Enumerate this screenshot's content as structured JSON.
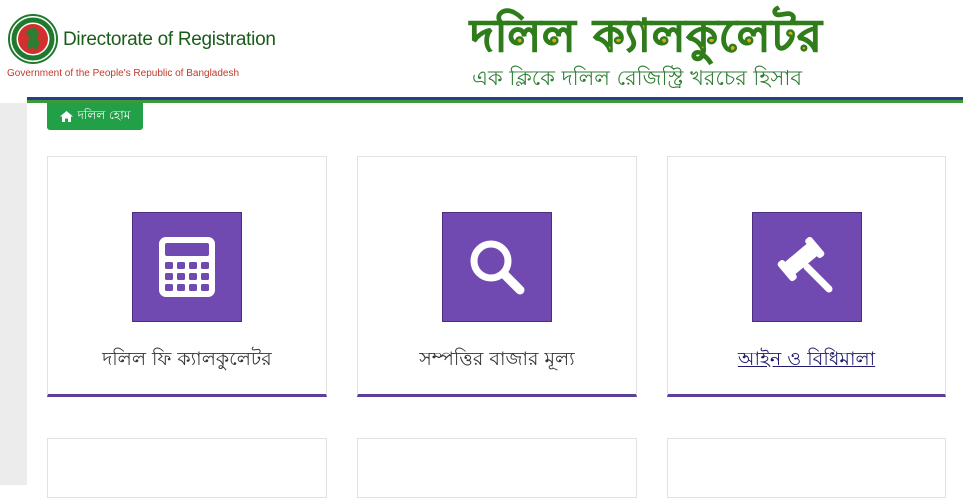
{
  "header": {
    "org_name": "Directorate of Registration",
    "gov_name": "Government of the People's Republic of Bangladesh",
    "app_title": "দলিল ক্যালকুলেটর",
    "app_subtitle": "এক ক্লিকে দলিল রেজিস্ট্রি খরচের হিসাব"
  },
  "nav": {
    "home_label": "দলিল হোম",
    "home_icon": "home-icon"
  },
  "cards": [
    {
      "label": "দলিল ফি ক্যালকুলেটর",
      "icon": "calculator-icon"
    },
    {
      "label": "সম্পত্তির বাজার মূল্য",
      "icon": "search-icon"
    },
    {
      "label": "আইন ও বিধিমালা",
      "icon": "gavel-icon"
    }
  ],
  "colors": {
    "accent_purple": "#7049b1",
    "green": "#22a047",
    "title_gold": "#e3a814",
    "navy": "#243f86"
  }
}
